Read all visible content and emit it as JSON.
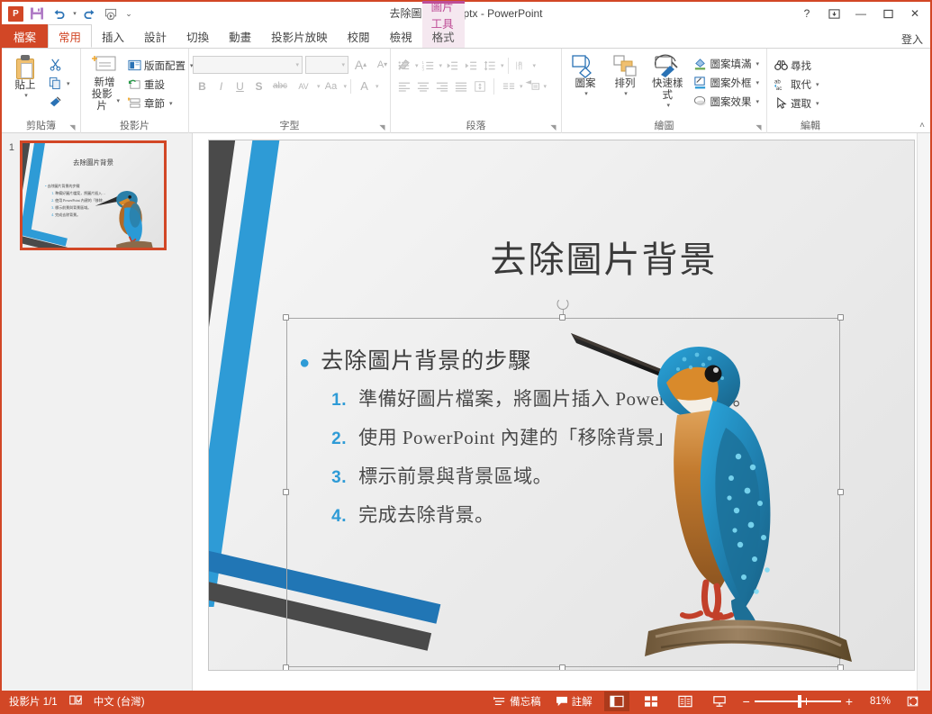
{
  "titlebar": {
    "doc_title": "去除圖片背景.pptx - PowerPoint",
    "qat": [
      {
        "name": "powerpoint-logo",
        "label": "P"
      },
      {
        "name": "save-icon",
        "label": "儲存檔案"
      },
      {
        "name": "undo-icon",
        "label": "復原"
      },
      {
        "name": "redo-icon",
        "label": "重做"
      },
      {
        "name": "start-slideshow-icon",
        "label": "從開頭開始"
      },
      {
        "name": "customize-qat-icon",
        "label": "自訂快速存取工具列"
      }
    ],
    "help": "?",
    "ribbon_display": "⊼",
    "minimize": "—",
    "maximize": "❐",
    "close": "✕",
    "signin": "登入"
  },
  "contextual": {
    "group_label": "圖片工具",
    "accent": "#bf4e97"
  },
  "tabs": [
    {
      "label": "檔案",
      "kind": "file"
    },
    {
      "label": "常用",
      "kind": "active"
    },
    {
      "label": "插入",
      "kind": "normal"
    },
    {
      "label": "設計",
      "kind": "normal"
    },
    {
      "label": "切換",
      "kind": "normal"
    },
    {
      "label": "動畫",
      "kind": "normal"
    },
    {
      "label": "投影片放映",
      "kind": "normal"
    },
    {
      "label": "校閱",
      "kind": "normal"
    },
    {
      "label": "檢視",
      "kind": "normal"
    },
    {
      "label": "格式",
      "kind": "contextual"
    }
  ],
  "ribbon": {
    "clipboard": {
      "group_label": "剪貼簿",
      "paste": "貼上",
      "cut": "剪下",
      "copy": "複製",
      "format_painter": "複製格式"
    },
    "slides": {
      "group_label": "投影片",
      "new_slide": "新增\n投影片",
      "new_slide_line1": "新增",
      "new_slide_line2": "投影片",
      "layout": "版面配置",
      "reset": "重設",
      "section": "章節"
    },
    "font": {
      "group_label": "字型",
      "font_name_value": "",
      "font_size_value": "",
      "grow_font": "A",
      "shrink_font": "A",
      "clear_formatting": "清除所有格式設定",
      "bold": "B",
      "italic": "I",
      "underline": "U",
      "shadow": "S",
      "strikethrough": "abc",
      "char_spacing": "AV",
      "change_case": "Aa",
      "font_color": "A"
    },
    "paragraph": {
      "group_label": "段落",
      "bullets": "項目符號",
      "numbering": "編號",
      "decrease_indent": "減少縮排",
      "increase_indent": "增加縮排",
      "line_spacing": "行距",
      "text_direction": "文字方向",
      "align_text": "對齊文字",
      "convert_smartart": "轉換成 SmartArt",
      "align_left": "靠左對齊",
      "align_center": "置中",
      "align_right": "靠右對齊",
      "justify": "左右對齊",
      "columns": "欄"
    },
    "drawing": {
      "group_label": "繪圖",
      "shapes": "圖案",
      "arrange": "排列",
      "quick_styles": "快速樣式",
      "shape_fill": "圖案填滿",
      "shape_outline": "圖案外框",
      "shape_effects": "圖案效果"
    },
    "editing": {
      "group_label": "編輯",
      "find": "尋找",
      "replace": "取代",
      "select": "選取"
    },
    "collapse_ribbon": "˄"
  },
  "thumbnails": [
    {
      "number": "1",
      "selected": true
    }
  ],
  "slide": {
    "title": "去除圖片背景",
    "bullet_main": "去除圖片背景的步驟",
    "steps": [
      {
        "num": "1.",
        "text": "準備好圖片檔案，將圖片插入 PowerPoint 中。"
      },
      {
        "num": "2.",
        "text": "使用 PowerPoint 內建的「移除背景」功能。"
      },
      {
        "num": "3.",
        "text": "標示前景與背景區域。"
      },
      {
        "num": "4.",
        "text": "完成去除背景。"
      }
    ],
    "picture_alt": "翠鳥站在樹枝上的圖片",
    "theme_accent": "#2e9bd6",
    "theme_dark": "#4a4a4a"
  },
  "statusbar": {
    "slide_count": "投影片 1/1",
    "spellcheck_icon": "拼字檢查",
    "language": "中文 (台灣)",
    "notes": "備忘稿",
    "comments": "註解",
    "views": [
      {
        "name": "normal-view",
        "label": "標準模式",
        "active": true
      },
      {
        "name": "slide-sorter-view",
        "label": "投影片瀏覽",
        "active": false
      },
      {
        "name": "reading-view",
        "label": "閱讀檢視",
        "active": false
      },
      {
        "name": "slideshow-view",
        "label": "投影片放映",
        "active": false
      }
    ],
    "zoom_out": "−",
    "zoom_in": "+",
    "zoom_level": "81%",
    "fit_slide": "配合視窗調整投影片大小"
  }
}
